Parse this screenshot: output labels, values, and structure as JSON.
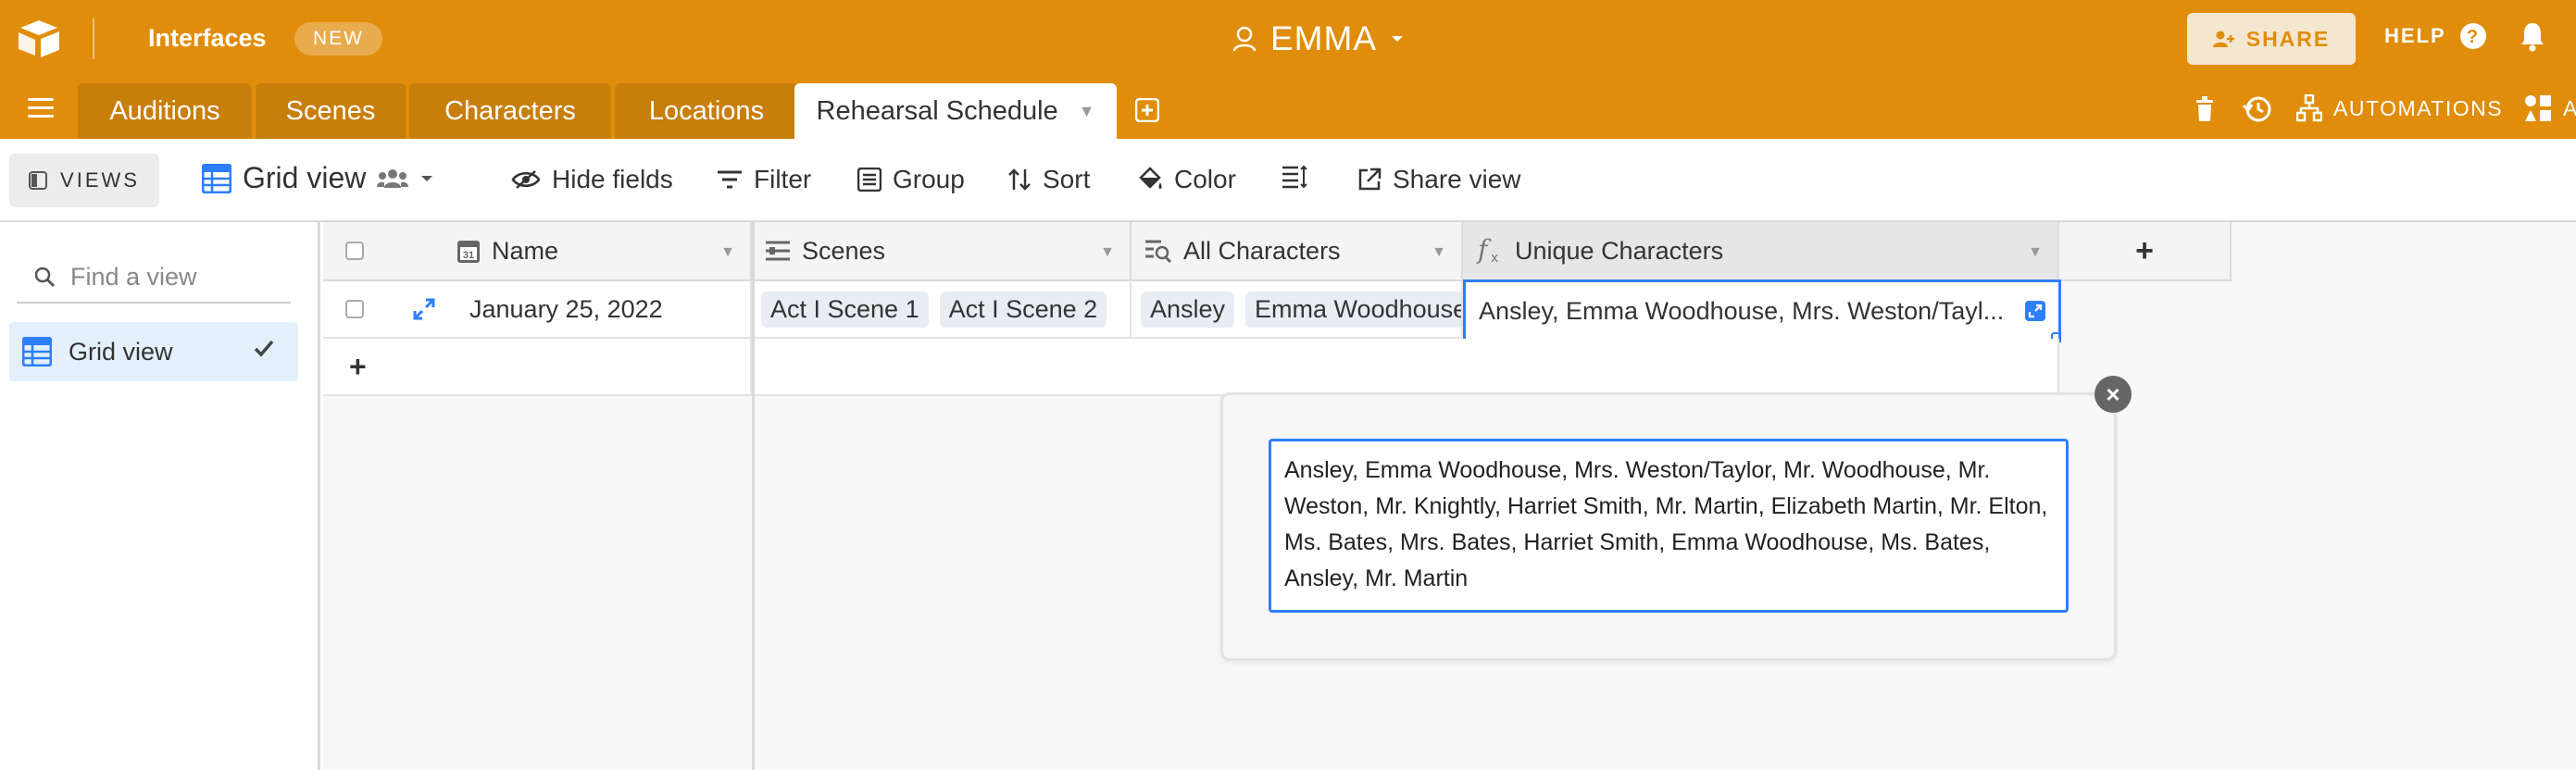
{
  "header": {
    "interfaces_label": "Interfaces",
    "new_badge": "NEW",
    "base_name": "EMMA",
    "share_label": "SHARE",
    "help_label": "HELP"
  },
  "tabs": [
    {
      "label": "Auditions",
      "active": false
    },
    {
      "label": "Scenes",
      "active": false
    },
    {
      "label": "Characters",
      "active": false
    },
    {
      "label": "Locations",
      "active": false
    },
    {
      "label": "Rehearsal Schedule",
      "active": true
    }
  ],
  "tools": {
    "automations_label": "AUTOMATIONS",
    "apps_label": "A"
  },
  "viewbar": {
    "views_label": "VIEWS",
    "view_name": "Grid view",
    "hide_fields": "Hide fields",
    "filter": "Filter",
    "group": "Group",
    "sort": "Sort",
    "color": "Color",
    "share_view": "Share view"
  },
  "sidebar": {
    "find_placeholder": "Find a view",
    "views": [
      {
        "label": "Grid view",
        "selected": true
      }
    ]
  },
  "grid": {
    "columns": [
      {
        "label": "Name",
        "icon": "calendar-icon"
      },
      {
        "label": "Scenes",
        "icon": "linked-record-icon"
      },
      {
        "label": "All Characters",
        "icon": "lookup-icon"
      },
      {
        "label": "Unique Characters",
        "icon": "formula-icon"
      }
    ],
    "add_field_label": "+",
    "add_row_label": "+",
    "rows": [
      {
        "name": "January 25, 2022",
        "scenes": [
          "Act I Scene 1",
          "Act I Scene 2"
        ],
        "all_characters": [
          "Ansley",
          "Emma Woodhouse"
        ],
        "unique_characters": "Ansley, Emma Woodhouse, Mrs. Weston/Tayl..."
      }
    ]
  },
  "editor": {
    "text": "Ansley, Emma Woodhouse, Mrs. Weston/Taylor, Mr. Woodhouse, Mr. Weston, Mr. Knightly, Harriet Smith, Mr. Martin, Elizabeth Martin, Mr. Elton, Ms. Bates, Mrs. Bates, Harriet Smith, Emma Woodhouse, Ms. Bates, Ansley, Mr. Martin",
    "close_label": "×"
  },
  "colors": {
    "brand": "#e08d0b",
    "selection": "#2d7ff9",
    "grid_icon": "#2d7ff9"
  }
}
